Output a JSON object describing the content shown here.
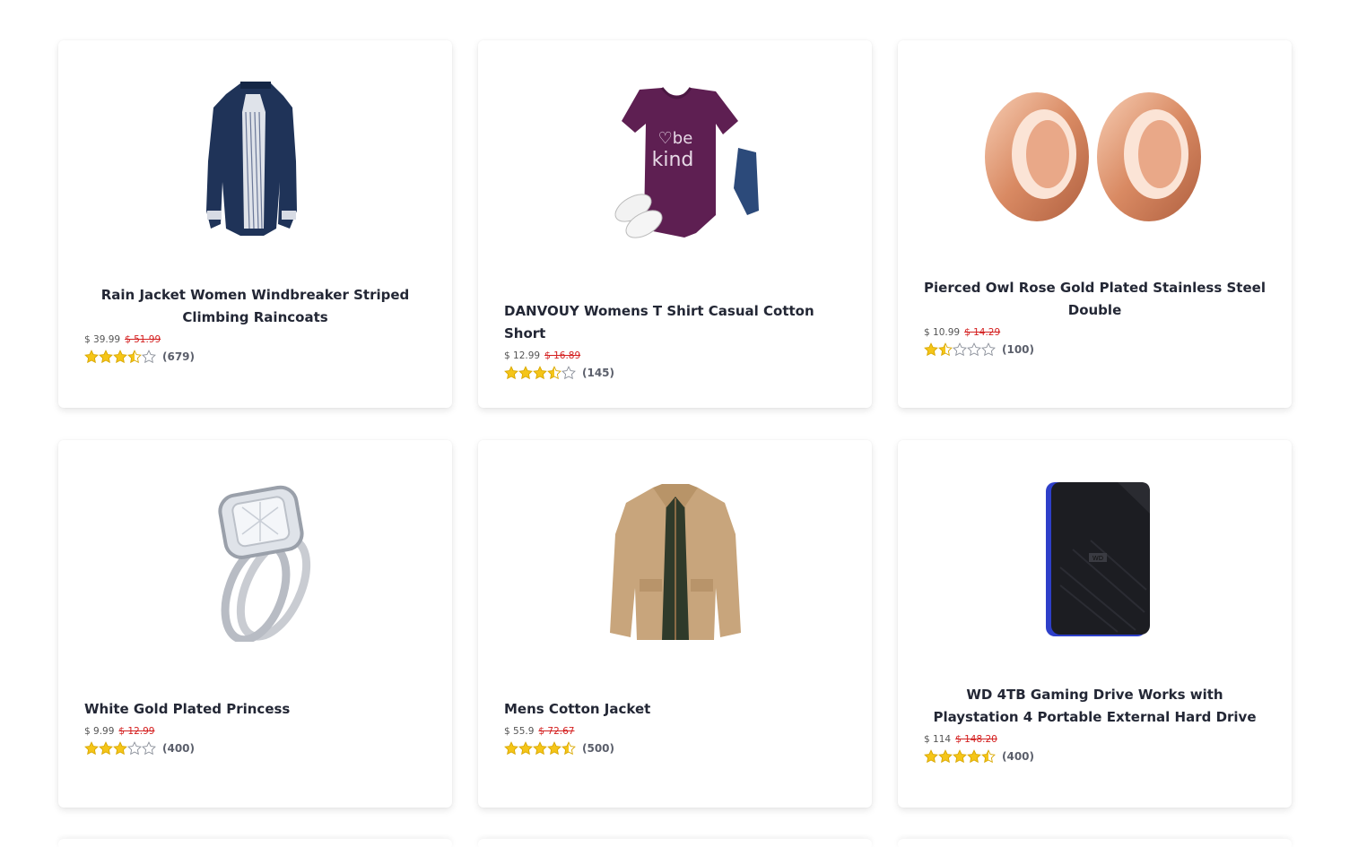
{
  "products": [
    {
      "title": "Rain Jacket Women Windbreaker Striped Climbing Raincoats",
      "price": "$ 39.99",
      "old_price": "$ 51.99",
      "rating": 3.5,
      "reviews": "(679)"
    },
    {
      "title": "DANVOUY Womens T Shirt Casual Cotton Short",
      "price": "$ 12.99",
      "old_price": "$ 16.89",
      "rating": 3.5,
      "reviews": "(145)"
    },
    {
      "title": "Pierced Owl Rose Gold Plated Stainless Steel Double",
      "price": "$ 10.99",
      "old_price": "$ 14.29",
      "rating": 1.5,
      "reviews": "(100)"
    },
    {
      "title": "White Gold Plated Princess",
      "price": "$ 9.99",
      "old_price": "$ 12.99",
      "rating": 3,
      "reviews": "(400)"
    },
    {
      "title": "Mens Cotton Jacket",
      "price": "$ 55.9",
      "old_price": "$ 72.67",
      "rating": 4.5,
      "reviews": "(500)"
    },
    {
      "title": "WD 4TB Gaming Drive Works with Playstation 4 Portable External Hard Drive",
      "price": "$ 114",
      "old_price": "$ 148.20",
      "rating": 4.5,
      "reviews": "(400)"
    }
  ],
  "colors": {
    "star": "#f5c518",
    "star_empty": "#8a8f99",
    "old_price": "#d42020"
  },
  "icons": [
    "rain-jacket-image",
    "tshirt-image",
    "rose-gold-plugs-image",
    "diamond-ring-image",
    "cotton-jacket-image",
    "hard-drive-image",
    "star-icon"
  ]
}
